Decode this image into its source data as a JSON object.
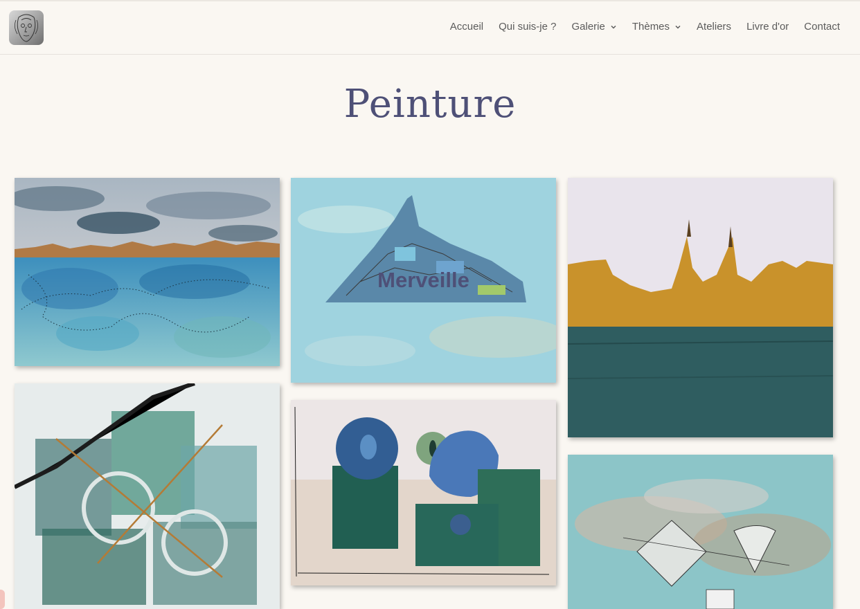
{
  "header": {
    "logo_icon": "face-sketch-logo-icon",
    "nav": [
      {
        "label": "Accueil",
        "dropdown": false
      },
      {
        "label": "Qui suis-je ?",
        "dropdown": false
      },
      {
        "label": "Galerie",
        "dropdown": true
      },
      {
        "label": "Thèmes",
        "dropdown": true
      },
      {
        "label": "Ateliers",
        "dropdown": false
      },
      {
        "label": "Livre d'or",
        "dropdown": false
      },
      {
        "label": "Contact",
        "dropdown": false
      }
    ]
  },
  "page": {
    "title": "Peinture"
  },
  "gallery": {
    "tiles": [
      {
        "id": "watercolor-coast",
        "label": ""
      },
      {
        "id": "mont-saint-michel",
        "label": "Merveille"
      },
      {
        "id": "golden-skyline",
        "label": ""
      },
      {
        "id": "abstract-green",
        "label": ""
      },
      {
        "id": "blue-shapes",
        "label": ""
      },
      {
        "id": "abstract-turquoise",
        "label": ""
      }
    ]
  },
  "colors": {
    "background": "#faf7f2",
    "nav_text": "#5b5b5b",
    "title": "#4e5077"
  }
}
